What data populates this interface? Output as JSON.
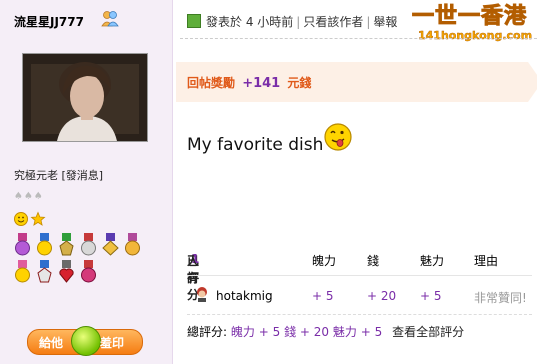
{
  "user": {
    "name": "流星星JJ777",
    "rank": "究極元老",
    "message_link": "[發消息]"
  },
  "post": {
    "meta": "發表於 4 小時前",
    "only_author": "只看該作者",
    "report": "舉報",
    "reward_label": "回帖獎勵",
    "reward_amount": "+141",
    "reward_unit": "元錢",
    "body": "My favorite dish"
  },
  "brand": {
    "cn": "一世一香港",
    "en": "141hongkong.com"
  },
  "rating": {
    "has_prefix": "已有",
    "count": "1",
    "suffix": "人評分",
    "columns": [
      "魄力",
      "錢",
      "魅力",
      "理由"
    ],
    "rows": [
      {
        "user": "hotakmig",
        "power": "+ 5",
        "money": "+ 20",
        "charm": "+ 5",
        "reason": "非常贊同!"
      }
    ],
    "total_label": "總評分:",
    "total_power_label": "魄力",
    "total_power": "+ 5",
    "total_money_label": "錢",
    "total_money": "+ 20",
    "total_charm_label": "魅力",
    "total_charm": "+ 5",
    "view_all": "查看全部評分"
  },
  "give_button": {
    "left": "給他",
    "right": "羞印"
  }
}
